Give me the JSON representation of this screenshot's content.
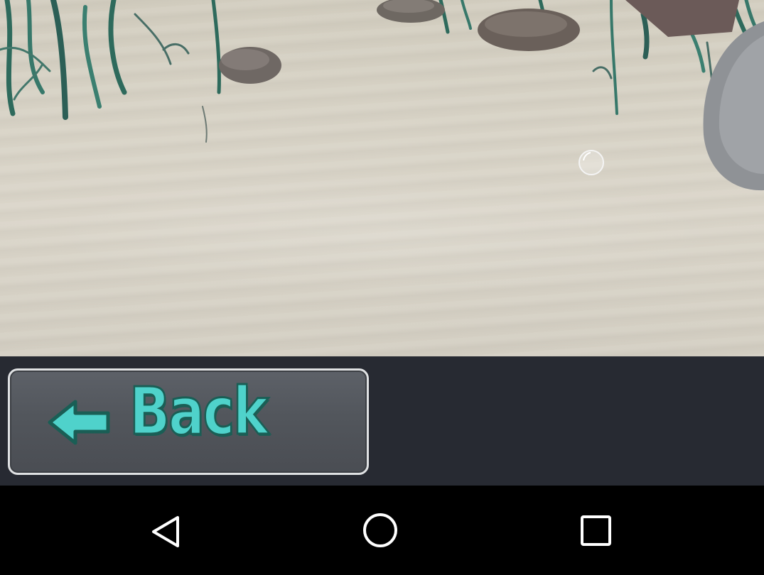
{
  "scene": {
    "description_icon": "sea-floor",
    "bubble_icon": "bubble-icon"
  },
  "back_button": {
    "label": "Back",
    "icon": "arrow-left-icon"
  },
  "navbar": {
    "back_icon": "triangle-back-icon",
    "home_icon": "circle-home-icon",
    "recent_icon": "square-recent-icon"
  },
  "colors": {
    "sand": "#d7d2c5",
    "panel": "#272a32",
    "button_face": "#52565c",
    "button_border": "#dfe1e3",
    "label_fill": "#4fd2cb",
    "label_outline": "#1a5e55",
    "navbar": "#000000"
  }
}
